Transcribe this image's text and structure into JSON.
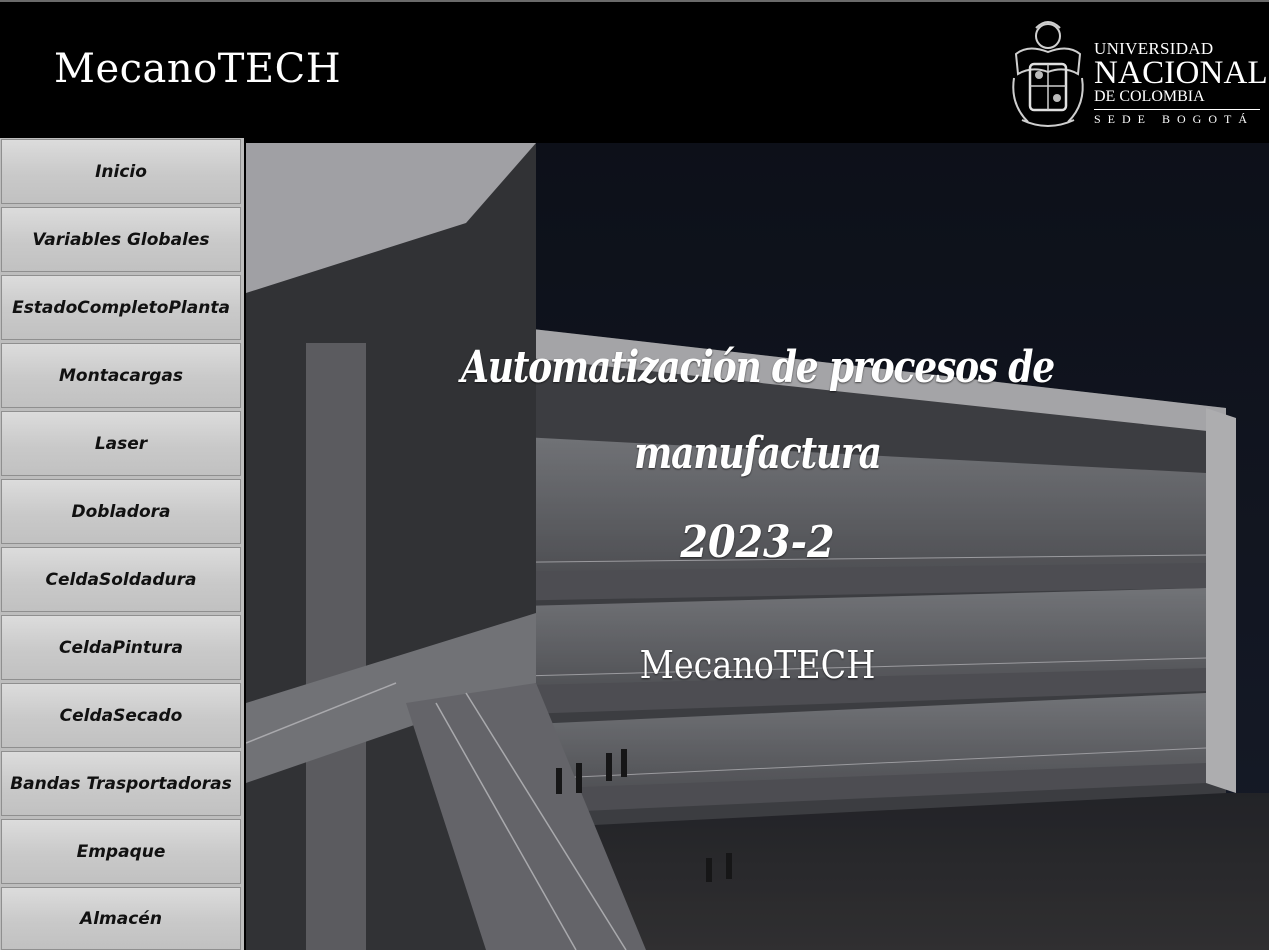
{
  "header": {
    "brand": "MecanoTECH",
    "logo": {
      "line1": "UNIVERSIDAD",
      "line2": "NACIONAL",
      "line3": "DE COLOMBIA",
      "line4": "SEDE BOGOTÁ"
    }
  },
  "sidebar": {
    "items": [
      {
        "label": "Inicio"
      },
      {
        "label": "Variables Globales"
      },
      {
        "label": "EstadoCompletoPlanta"
      },
      {
        "label": "Montacargas"
      },
      {
        "label": "Laser"
      },
      {
        "label": "Dobladora"
      },
      {
        "label": "CeldaSoldadura"
      },
      {
        "label": "CeldaPintura"
      },
      {
        "label": "CeldaSecado"
      },
      {
        "label": "Bandas Trasportadoras"
      },
      {
        "label": "Empaque"
      },
      {
        "label": "Almacén"
      }
    ]
  },
  "hero": {
    "title_line1": "Automatización de procesos de",
    "title_line2": "manufactura",
    "year": "2023-2",
    "brand": "MecanoTECH"
  },
  "colors": {
    "header_bg": "#000000",
    "sidebar_button": "#c9c9c9",
    "text_light": "#ffffff"
  }
}
